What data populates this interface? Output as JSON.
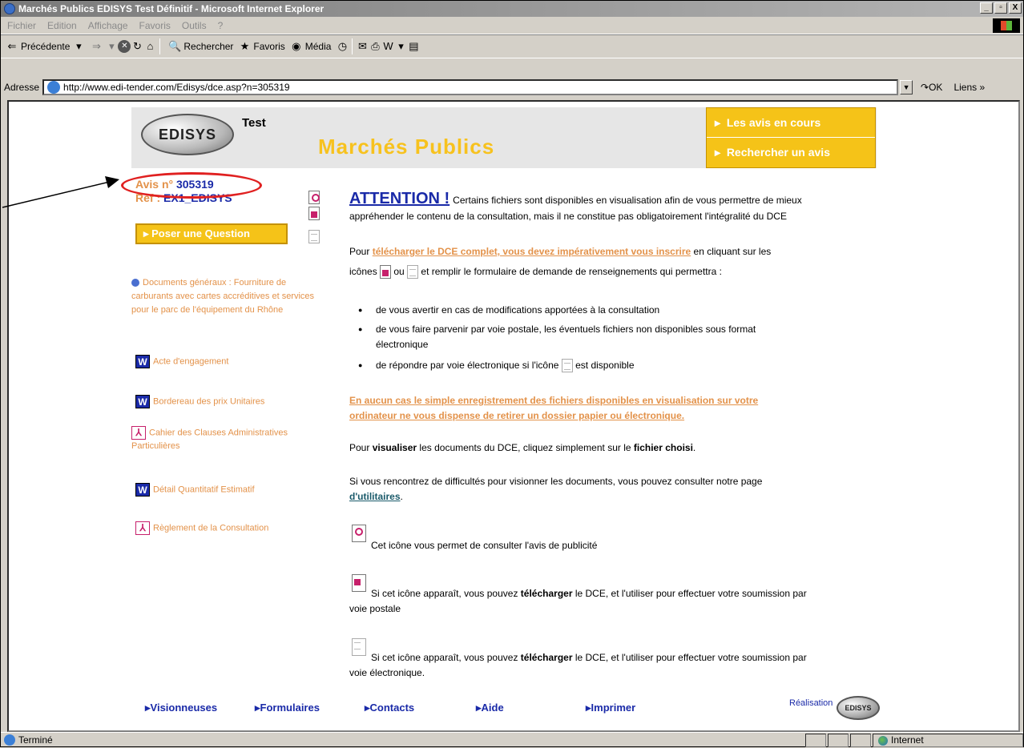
{
  "window": {
    "title": "Marchés Publics EDISYS Test Définitif - Microsoft Internet Explorer",
    "buttons": [
      "_",
      "▫",
      "X"
    ]
  },
  "menu": [
    "Fichier",
    "Edition",
    "Affichage",
    "Favoris",
    "Outils",
    "?"
  ],
  "toolbar": {
    "back_label": "Précédente",
    "search_label": "Rechercher",
    "favorites_label": "Favoris",
    "media_label": "Média"
  },
  "address": {
    "label": "Adresse",
    "url": "http://www.edi-tender.com/Edisys/dce.asp?n=305319",
    "go_label": "OK",
    "links_label": "Liens »"
  },
  "banner": {
    "logo_text": "EDISYS",
    "test_label": "Test",
    "title": "Marchés Publics",
    "nav": [
      "Les avis en cours",
      "Rechercher un avis"
    ]
  },
  "avis": {
    "label": "Avis n°",
    "value": "305319",
    "ref_label": "Réf :",
    "ref_value": "EX1_EDISYS"
  },
  "question_button": "Poser une Question",
  "documents_title": "Documents généraux : Fourniture de carburants avec cartes accréditives et services pour le parc de l'équipement du Rhône",
  "documents": [
    {
      "type": "word",
      "label": "Acte d'engagement"
    },
    {
      "type": "word",
      "label": "Bordereau des prix Unitaires"
    },
    {
      "type": "pdf",
      "label": "Cahier des Clauses Administratives Particulières"
    },
    {
      "type": "word",
      "label": "Détail Quantitatif Estimatif"
    },
    {
      "type": "pdf",
      "label": "Règlement de la Consultation"
    }
  ],
  "main": {
    "attention": "ATTENTION !",
    "attention_text1": "Certains fichiers sont disponibles en visualisation afin de vous permettre de mieux",
    "attention_text2": "appréhender le contenu de la consultation, mais il ne constitue pas obligatoirement l'intégralité du DCE",
    "p2_a": "Pour",
    "p2_link": "télécharger le DCE complet, vous devez impérativement vous inscrire",
    "p2_b": "en cliquant sur les",
    "p2_c_pre": "icônes",
    "p2_c_ou": "ou",
    "p2_c_post": "et remplir le formulaire de demande de renseignements qui permettra :",
    "bullets": [
      "de vous avertir en cas de modifications apportées à la consultation",
      "de vous faire parvenir par voie postale, les éventuels fichiers non disponibles sous format",
      "électronique",
      "de répondre par voie électronique si l'icône",
      "est disponible"
    ],
    "warning1": "En aucun cas le simple enregistrement des fichiers disponibles en visualisation sur votre",
    "warning2": "ordinateur ne vous dispense de retirer un dossier papier ou électronique.",
    "visu_a": "Pour",
    "visu_b": "visualiser",
    "visu_c": "les documents du DCE, cliquez simplement sur le",
    "visu_d": "fichier choisi",
    "diff1": "Si vous rencontrez de difficultés pour visionner les documents, vous pouvez consulter notre page",
    "diff_link": "d'utilitaires",
    "icon1_text": "Cet icône vous permet de consulter l'avis de publicité",
    "icon2_a": "Si cet icône apparaît, vous pouvez",
    "icon2_b": "télécharger",
    "icon2_c": "le DCE, et l'utiliser pour effectuer votre soumission par",
    "icon2_d": "voie postale",
    "icon3_a": "Si cet icône apparaît, vous pouvez",
    "icon3_b": "télécharger",
    "icon3_c": "le DCE, et l'utiliser pour effectuer votre soumission par",
    "icon3_d": "voie électronique."
  },
  "footer": {
    "links": [
      "Visionneuses",
      "Formulaires",
      "Contacts",
      "Aide",
      "Imprimer"
    ],
    "realisation": "Réalisation"
  },
  "status": {
    "left": "Terminé",
    "zone": "Internet"
  }
}
